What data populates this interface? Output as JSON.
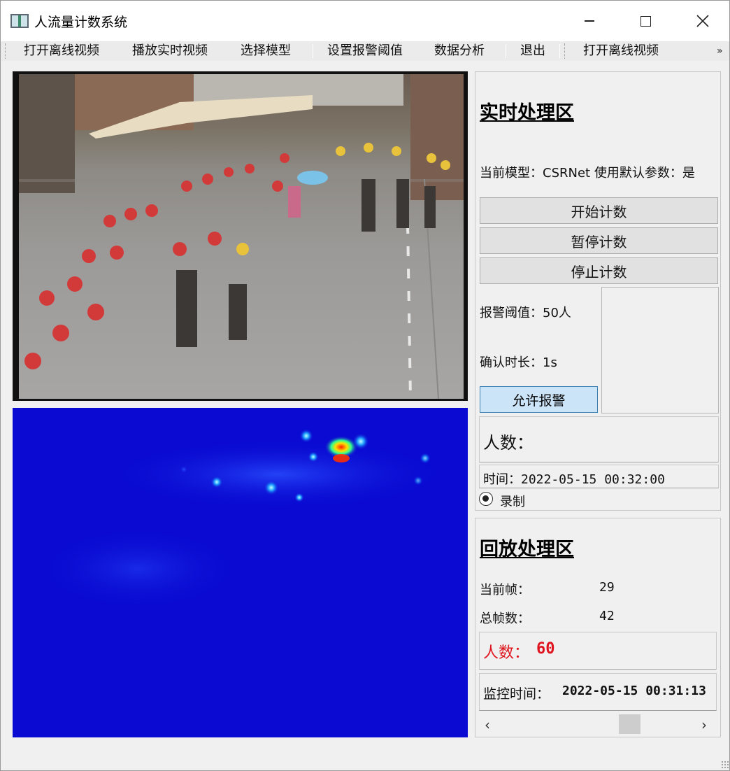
{
  "window": {
    "title": "人流量计数系统"
  },
  "toolbar": {
    "items": [
      "打开离线视频",
      "播放实时视频",
      "选择模型",
      "设置报警阈值",
      "数据分析",
      "退出",
      "打开离线视频"
    ],
    "overflow": "»"
  },
  "live": {
    "title": "实时处理区",
    "model_text": "当前模型：CSRNet 使用默认参数：是",
    "buttons": {
      "start": "开始计数",
      "pause": "暂停计数",
      "stop": "停止计数"
    },
    "alarm_threshold": "报警阈值：50人",
    "confirm_duration": "确认时长：1s",
    "allow_alarm": "允许报警",
    "people_label": "人数：",
    "time_text": "时间：2022-05-15 00:32:00",
    "record_label": "录制",
    "record_checked": true
  },
  "playback": {
    "title": "回放处理区",
    "current_frame_label": "当前帧：",
    "current_frame_value": "29",
    "total_frames_label": "总帧数：",
    "total_frames_value": "42",
    "people_label": "人数：",
    "people_value": "60",
    "monitor_time_label": "监控时间：",
    "monitor_time_value": "2022-05-15 00:31:13"
  },
  "colors": {
    "heatmap_bg": "#0a0ad2",
    "people_red": "#e0141e",
    "allow_alarm_bg": "#cce4f7"
  },
  "icons": {
    "close": "close-icon",
    "maximize": "maximize-icon",
    "minimize": "minimize-icon",
    "scroll_left": "chevron-left-icon",
    "scroll_right": "chevron-right-icon"
  }
}
